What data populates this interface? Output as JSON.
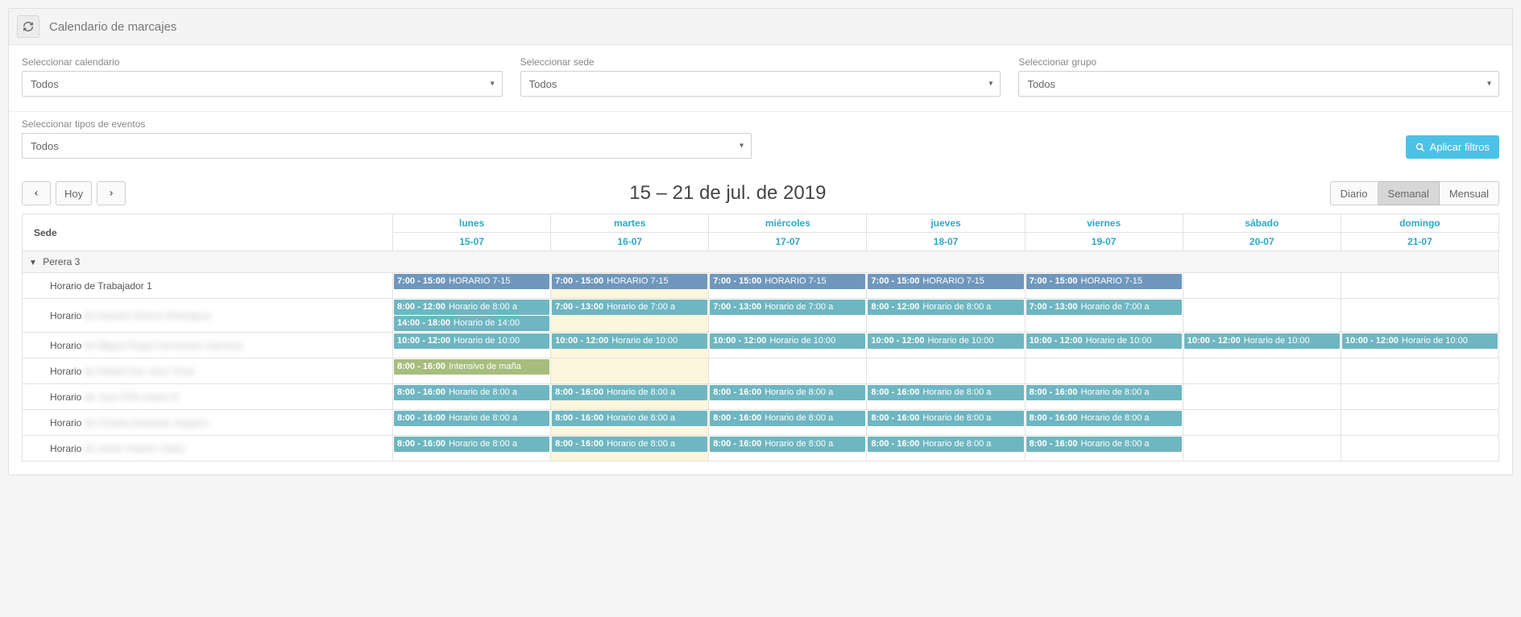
{
  "header": {
    "title": "Calendario de marcajes"
  },
  "filters": {
    "calendar": {
      "label": "Seleccionar calendario",
      "value": "Todos"
    },
    "sede": {
      "label": "Seleccionar sede",
      "value": "Todos"
    },
    "grupo": {
      "label": "Seleccionar grupo",
      "value": "Todos"
    },
    "tipos": {
      "label": "Seleccionar tipos de eventos",
      "value": "Todos"
    },
    "apply_label": "Aplicar filtros"
  },
  "toolbar": {
    "today_label": "Hoy",
    "title": "15 – 21 de jul. de 2019",
    "views": {
      "daily": "Diario",
      "weekly": "Semanal",
      "monthly": "Mensual",
      "active": "weekly"
    }
  },
  "calendar": {
    "resource_header": "Sede",
    "days": [
      {
        "name": "lunes",
        "date": "15-07",
        "today": false
      },
      {
        "name": "martes",
        "date": "16-07",
        "today": true
      },
      {
        "name": "miércoles",
        "date": "17-07",
        "today": false
      },
      {
        "name": "jueves",
        "date": "18-07",
        "today": false
      },
      {
        "name": "viernes",
        "date": "19-07",
        "today": false
      },
      {
        "name": "sábado",
        "date": "20-07",
        "today": false
      },
      {
        "name": "domingo",
        "date": "21-07",
        "today": false
      }
    ],
    "group": {
      "name": "Perera 3"
    },
    "rows": [
      {
        "label": "Horario de Trabajador 1",
        "blurred": false,
        "cells": [
          [
            {
              "time": "7:00 - 15:00",
              "title": "HORARIO 7-15",
              "cls": "ev-blue"
            }
          ],
          [
            {
              "time": "7:00 - 15:00",
              "title": "HORARIO 7-15",
              "cls": "ev-blue"
            }
          ],
          [
            {
              "time": "7:00 - 15:00",
              "title": "HORARIO 7-15",
              "cls": "ev-blue"
            }
          ],
          [
            {
              "time": "7:00 - 15:00",
              "title": "HORARIO 7-15",
              "cls": "ev-blue"
            }
          ],
          [
            {
              "time": "7:00 - 15:00",
              "title": "HORARIO 7-15",
              "cls": "ev-blue"
            }
          ],
          [],
          []
        ]
      },
      {
        "label": "Horario",
        "blurred": true,
        "blur_text": "de Nazario Ramos Rodríguez",
        "cells": [
          [
            {
              "time": "8:00 - 12:00",
              "title": "Horario de 8:00 a",
              "cls": "ev-teal"
            },
            {
              "time": "14:00 - 18:00",
              "title": "Horario de 14:00",
              "cls": "ev-teal"
            }
          ],
          [
            {
              "time": "7:00 - 13:00",
              "title": "Horario de 7:00 a",
              "cls": "ev-teal"
            }
          ],
          [
            {
              "time": "7:00 - 13:00",
              "title": "Horario de 7:00 a",
              "cls": "ev-teal"
            }
          ],
          [
            {
              "time": "8:00 - 12:00",
              "title": "Horario de 8:00 a",
              "cls": "ev-teal"
            }
          ],
          [
            {
              "time": "7:00 - 13:00",
              "title": "Horario de 7:00 a",
              "cls": "ev-teal"
            }
          ],
          [],
          []
        ]
      },
      {
        "label": "Horario",
        "blurred": true,
        "blur_text": "de Miguel Ángel Hernández Sánchez",
        "cells": [
          [
            {
              "time": "10:00 - 12:00",
              "title": "Horario de 10:00",
              "cls": "ev-teal"
            }
          ],
          [
            {
              "time": "10:00 - 12:00",
              "title": "Horario de 10:00",
              "cls": "ev-teal"
            }
          ],
          [
            {
              "time": "10:00 - 12:00",
              "title": "Horario de 10:00",
              "cls": "ev-teal"
            }
          ],
          [
            {
              "time": "10:00 - 12:00",
              "title": "Horario de 10:00",
              "cls": "ev-teal"
            }
          ],
          [
            {
              "time": "10:00 - 12:00",
              "title": "Horario de 10:00",
              "cls": "ev-teal"
            }
          ],
          [
            {
              "time": "10:00 - 12:00",
              "title": "Horario de 10:00",
              "cls": "ev-teal"
            }
          ],
          [
            {
              "time": "10:00 - 12:00",
              "title": "Horario de 10:00",
              "cls": "ev-teal"
            }
          ]
        ]
      },
      {
        "label": "Horario",
        "blurred": true,
        "blur_text": "de Rafael San José Tovar",
        "cells": [
          [
            {
              "time": "8:00 - 16:00",
              "title": "Intensivo de maña",
              "cls": "ev-olive"
            }
          ],
          [],
          [],
          [],
          [],
          [],
          []
        ]
      },
      {
        "label": "Horario",
        "blurred": true,
        "blur_text": "de Juan Piña Salas III",
        "cells": [
          [
            {
              "time": "8:00 - 16:00",
              "title": "Horario de 8:00 a",
              "cls": "ev-teal"
            }
          ],
          [
            {
              "time": "8:00 - 16:00",
              "title": "Horario de 8:00 a",
              "cls": "ev-teal"
            }
          ],
          [
            {
              "time": "8:00 - 16:00",
              "title": "Horario de 8:00 a",
              "cls": "ev-teal"
            }
          ],
          [
            {
              "time": "8:00 - 16:00",
              "title": "Horario de 8:00 a",
              "cls": "ev-teal"
            }
          ],
          [
            {
              "time": "8:00 - 16:00",
              "title": "Horario de 8:00 a",
              "cls": "ev-teal"
            }
          ],
          [],
          []
        ]
      },
      {
        "label": "Horario",
        "blurred": true,
        "blur_text": "de Cristina Alvarado Segarra",
        "cells": [
          [
            {
              "time": "8:00 - 16:00",
              "title": "Horario de 8:00 a",
              "cls": "ev-teal"
            }
          ],
          [
            {
              "time": "8:00 - 16:00",
              "title": "Horario de 8:00 a",
              "cls": "ev-teal"
            }
          ],
          [
            {
              "time": "8:00 - 16:00",
              "title": "Horario de 8:00 a",
              "cls": "ev-teal"
            }
          ],
          [
            {
              "time": "8:00 - 16:00",
              "title": "Horario de 8:00 a",
              "cls": "ev-teal"
            }
          ],
          [
            {
              "time": "8:00 - 16:00",
              "title": "Horario de 8:00 a",
              "cls": "ev-teal"
            }
          ],
          [],
          []
        ]
      },
      {
        "label": "Horario",
        "blurred": true,
        "blur_text": "de Javier Padrón Vladu",
        "cells": [
          [
            {
              "time": "8:00 - 16:00",
              "title": "Horario de 8:00 a",
              "cls": "ev-teal"
            }
          ],
          [
            {
              "time": "8:00 - 16:00",
              "title": "Horario de 8:00 a",
              "cls": "ev-teal"
            }
          ],
          [
            {
              "time": "8:00 - 16:00",
              "title": "Horario de 8:00 a",
              "cls": "ev-teal"
            }
          ],
          [
            {
              "time": "8:00 - 16:00",
              "title": "Horario de 8:00 a",
              "cls": "ev-teal"
            }
          ],
          [
            {
              "time": "8:00 - 16:00",
              "title": "Horario de 8:00 a",
              "cls": "ev-teal"
            }
          ],
          [],
          []
        ]
      }
    ]
  }
}
